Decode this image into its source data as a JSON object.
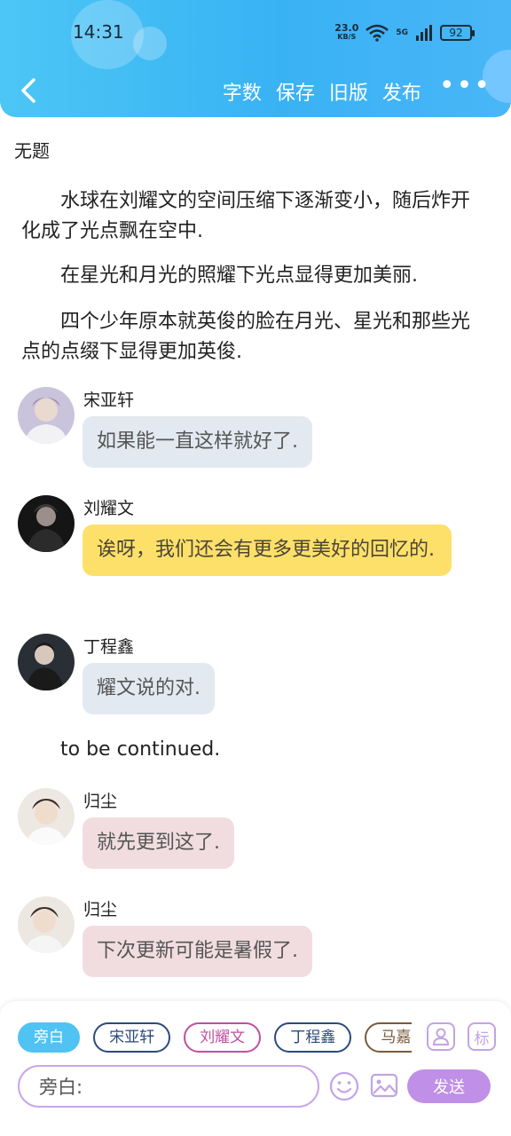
{
  "status_bar": {
    "time": "14:31",
    "net_speed": "23.0",
    "net_unit": "KB/S",
    "network": "5G",
    "battery": "92"
  },
  "header": {
    "actions": [
      "字数",
      "保存",
      "旧版",
      "发布"
    ],
    "more": "•••",
    "accent": "#39b2f4"
  },
  "doc": {
    "title": "无题",
    "paragraphs": [
      "水球在刘耀文的空间压缩下逐渐变小，随后炸开化成了光点飘在空中.",
      "在星光和月光的照耀下光点显得更加美丽.",
      "四个少年原本就英俊的脸在月光、星光和那些光点的点缀下显得更加英俊."
    ],
    "messages": [
      {
        "speaker": "宋亚轩",
        "text": "如果能一直这样就好了.",
        "color": "#e3e9f0"
      },
      {
        "speaker": "刘耀文",
        "text": "诶呀，我们还会有更多更美好的回忆的.",
        "color": "#fde06a"
      },
      {
        "speaker": "丁程鑫",
        "text": "耀文说的对.",
        "color": "#e3e9f0"
      }
    ],
    "narration": "to be continued.",
    "author_messages": [
      {
        "speaker": "归尘",
        "text": "就先更到这了."
      },
      {
        "speaker": "归尘",
        "text": "下次更新可能是暑假了."
      }
    ]
  },
  "composer": {
    "characters": [
      "旁白",
      "宋亚轩",
      "刘耀文",
      "丁程鑫",
      "马嘉祺"
    ],
    "mark_label": "标",
    "input_label": "旁白:",
    "send_label": "发送"
  }
}
